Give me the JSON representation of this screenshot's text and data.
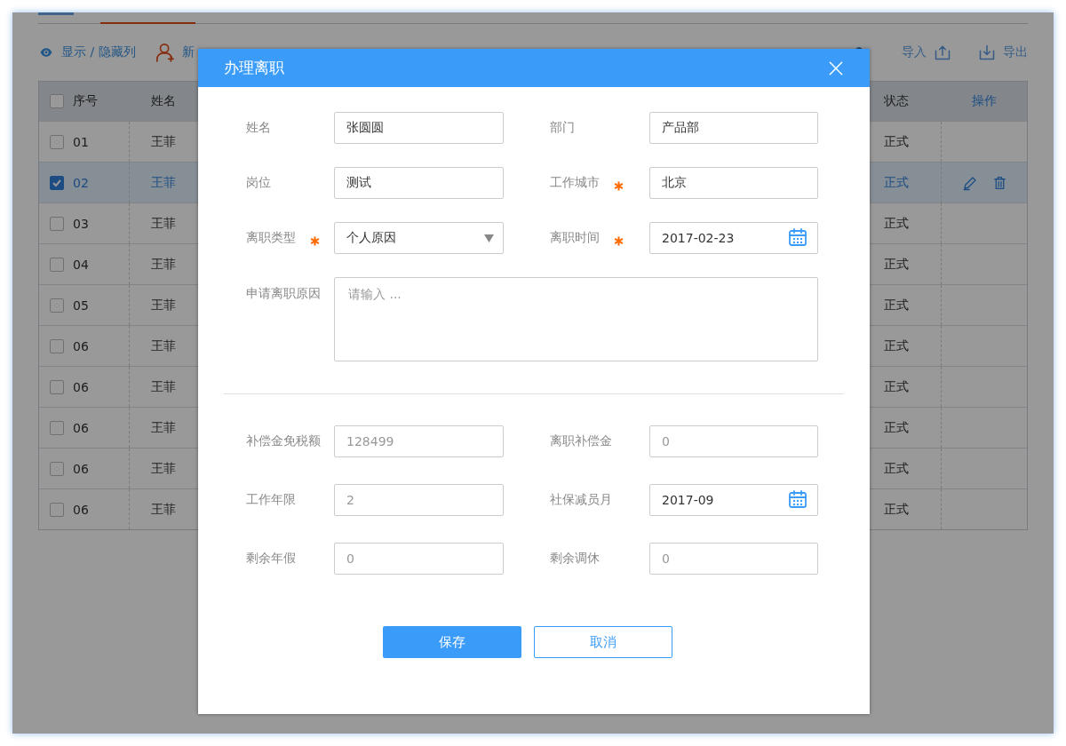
{
  "page": {
    "tabs": [
      {
        "selected": false
      },
      {
        "selected": true
      }
    ],
    "toolbar_left": [
      {
        "label": "显示 / 隐藏列",
        "kind": "eye"
      },
      {
        "label": "新",
        "kind": "person-add"
      }
    ],
    "toolbar_right": [
      {
        "label": "导入",
        "kind": "import"
      },
      {
        "label": "导出",
        "kind": "export"
      }
    ],
    "table": {
      "all_checked": false,
      "columns": [
        "序号",
        "姓名",
        "状态",
        "操作"
      ],
      "rows": [
        {
          "no": "01",
          "name": "王菲",
          "status": "正式",
          "checked": false,
          "selected": false
        },
        {
          "no": "02",
          "name": "王菲",
          "status": "正式",
          "checked": true,
          "selected": true
        },
        {
          "no": "03",
          "name": "王菲",
          "status": "正式",
          "checked": false,
          "selected": false
        },
        {
          "no": "04",
          "name": "王菲",
          "status": "正式",
          "checked": false,
          "selected": false
        },
        {
          "no": "05",
          "name": "王菲",
          "status": "正式",
          "checked": false,
          "selected": false
        },
        {
          "no": "06",
          "name": "王菲",
          "status": "正式",
          "checked": false,
          "selected": false
        },
        {
          "no": "06",
          "name": "王菲",
          "status": "正式",
          "checked": false,
          "selected": false
        },
        {
          "no": "06",
          "name": "王菲",
          "status": "正式",
          "checked": false,
          "selected": false
        },
        {
          "no": "06",
          "name": "王菲",
          "status": "正式",
          "checked": false,
          "selected": false
        },
        {
          "no": "06",
          "name": "王菲",
          "status": "正式",
          "checked": false,
          "selected": false
        }
      ]
    }
  },
  "dialog": {
    "title": "办理离职",
    "fields": [
      {
        "label": "姓名",
        "kind": "text",
        "value": "张圆圆",
        "required": false
      },
      {
        "label": "部门",
        "kind": "text",
        "value": "产品部",
        "required": false
      },
      {
        "label": "岗位",
        "kind": "text",
        "value": "测试",
        "required": false
      },
      {
        "label": "工作城市",
        "kind": "text",
        "value": "北京",
        "required": true
      },
      {
        "label": "离职类型",
        "kind": "select",
        "value": "个人原因",
        "required": true
      },
      {
        "label": "离职时间",
        "kind": "date",
        "value": "2017-02-23",
        "required": true
      },
      {
        "label": "申请离职原因",
        "kind": "textarea",
        "placeholder": "请输入 ...",
        "required": false
      }
    ],
    "extra_fields": [
      {
        "label": "补偿金免税额",
        "kind": "text",
        "value": "128499",
        "required": false,
        "disabled": true
      },
      {
        "label": "离职补偿金",
        "kind": "text",
        "value": "0",
        "required": false,
        "disabled": true
      },
      {
        "label": "工作年限",
        "kind": "text",
        "value": "2",
        "required": false,
        "disabled": true
      },
      {
        "label": "社保减员月",
        "kind": "date",
        "value": "2017-09",
        "required": false,
        "disabled": false
      },
      {
        "label": "剩余年假",
        "kind": "text",
        "value": "0",
        "required": false,
        "disabled": true
      },
      {
        "label": "剩余调休",
        "kind": "text",
        "value": "0",
        "required": false,
        "disabled": true
      }
    ],
    "buttons": [
      {
        "label": "保存",
        "kind": "primary"
      },
      {
        "label": "取消",
        "kind": "secondary"
      }
    ]
  }
}
